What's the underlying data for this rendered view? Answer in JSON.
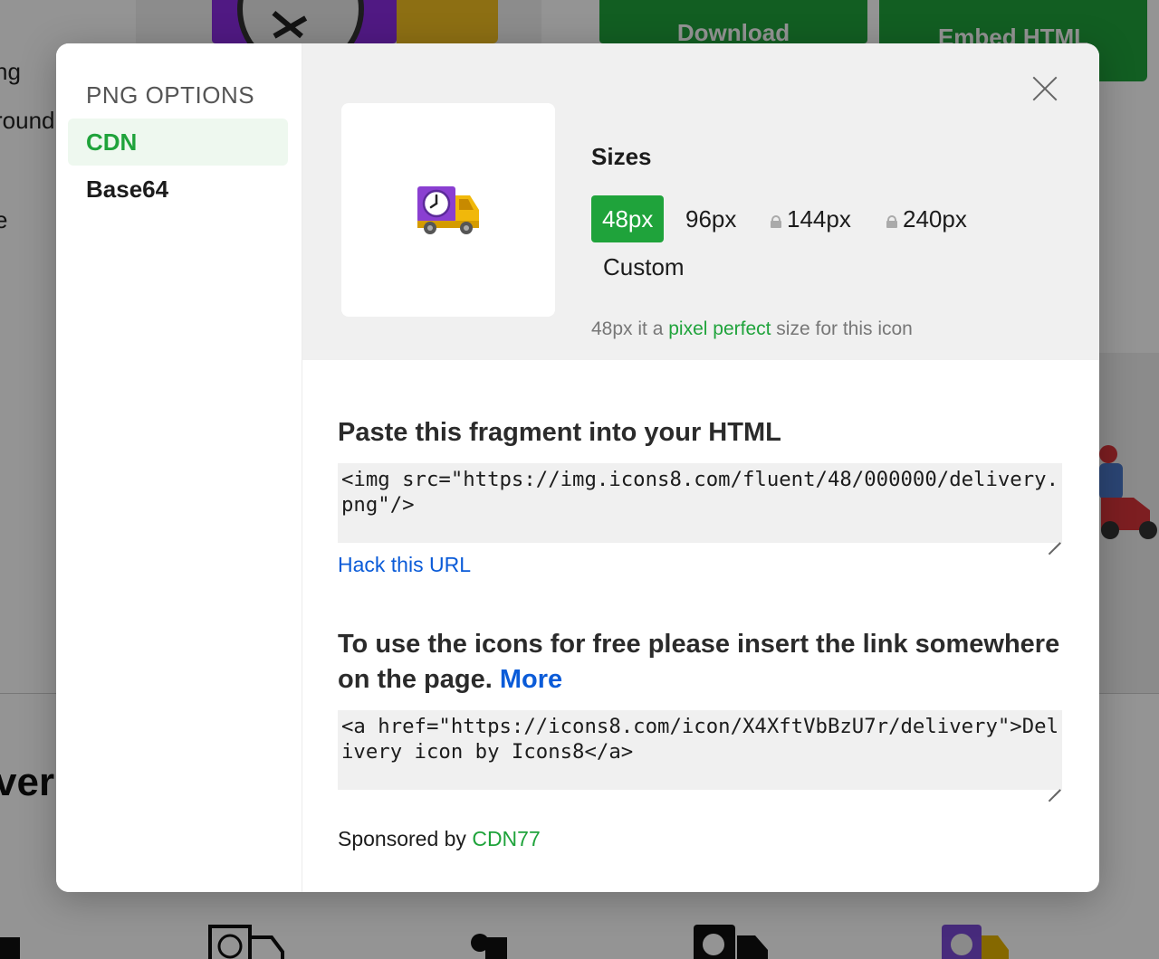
{
  "background": {
    "buttons": {
      "download": "Download",
      "embed": "Embed HTML"
    },
    "left_fragments": [
      "ng",
      "round",
      "e"
    ],
    "big_text": "ver"
  },
  "modal": {
    "sidebar": {
      "title": "PNG OPTIONS",
      "items": [
        {
          "label": "CDN",
          "active": true
        },
        {
          "label": "Base64",
          "active": false
        }
      ]
    },
    "icon_name": "delivery-truck-icon",
    "sizes": {
      "title": "Sizes",
      "options": [
        {
          "label": "48px",
          "selected": true,
          "locked": false
        },
        {
          "label": "96px",
          "selected": false,
          "locked": false
        },
        {
          "label": "144px",
          "selected": false,
          "locked": true
        },
        {
          "label": "240px",
          "selected": false,
          "locked": true
        },
        {
          "label": "Custom",
          "selected": false,
          "locked": false
        }
      ],
      "note_prefix": "48px it a ",
      "note_highlight": "pixel perfect",
      "note_suffix": " size for this icon"
    },
    "fragment": {
      "heading": "Paste this fragment into your HTML",
      "code": "<img src=\"https://img.icons8.com/fluent/48/000000/delivery.png\"/>",
      "hack_link": "Hack this URL"
    },
    "attribution": {
      "heading": "To use the icons for free please insert the link somewhere on the page.",
      "more_link": "More",
      "code": "<a href=\"https://icons8.com/icon/X4XftVbBzU7r/delivery\">Delivery icon by Icons8</a>"
    },
    "sponsor": {
      "prefix": "Sponsored by ",
      "name": "CDN77"
    }
  },
  "colors": {
    "accent": "#1fa33b",
    "link": "#0a5bd8",
    "panel": "#f0f0f0"
  }
}
